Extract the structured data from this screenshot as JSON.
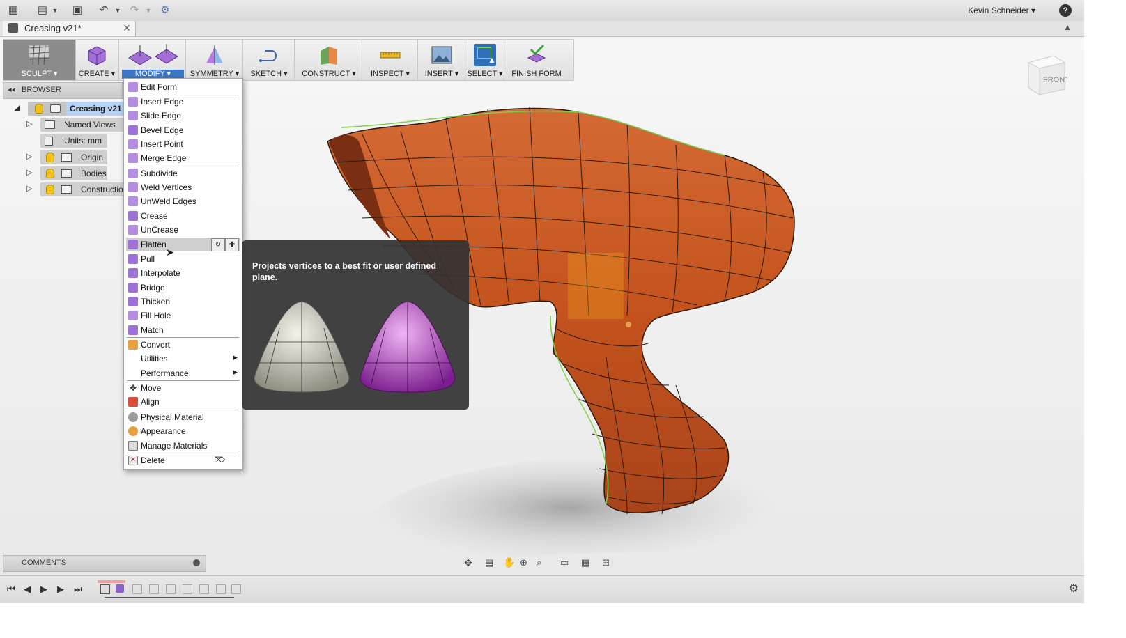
{
  "app": {
    "user": "Kevin Schneider",
    "help": "?"
  },
  "tab": {
    "title": "Creasing v21*"
  },
  "toolbar": {
    "sculpt": "SCULPT",
    "create": "CREATE",
    "modify": "MODIFY",
    "symmetry": "SYMMETRY",
    "sketch": "SKETCH",
    "construct": "CONSTRUCT",
    "inspect": "INSPECT",
    "insert": "INSERT",
    "select": "SELECT",
    "finish_form": "FINISH FORM"
  },
  "browser": {
    "title": "BROWSER",
    "items": [
      {
        "label": "Creasing v21"
      },
      {
        "label": "Named Views"
      },
      {
        "label": "Units: mm"
      },
      {
        "label": "Origin"
      },
      {
        "label": "Bodies"
      },
      {
        "label": "Constructio"
      }
    ]
  },
  "modify_menu": {
    "items": [
      {
        "label": "Edit Form"
      },
      {
        "label": "Insert Edge"
      },
      {
        "label": "Slide Edge"
      },
      {
        "label": "Bevel Edge"
      },
      {
        "label": "Insert Point"
      },
      {
        "label": "Merge Edge"
      },
      {
        "label": "Subdivide"
      },
      {
        "label": "Weld Vertices"
      },
      {
        "label": "UnWeld Edges"
      },
      {
        "label": "Crease"
      },
      {
        "label": "UnCrease"
      },
      {
        "label": "Flatten"
      },
      {
        "label": "Pull"
      },
      {
        "label": "Interpolate"
      },
      {
        "label": "Bridge"
      },
      {
        "label": "Thicken"
      },
      {
        "label": "Fill Hole"
      },
      {
        "label": "Match"
      },
      {
        "label": "Convert"
      },
      {
        "label": "Utilities"
      },
      {
        "label": "Performance"
      },
      {
        "label": "Move"
      },
      {
        "label": "Align"
      },
      {
        "label": "Physical Material"
      },
      {
        "label": "Appearance"
      },
      {
        "label": "Manage Materials"
      },
      {
        "label": "Delete"
      }
    ]
  },
  "tooltip": {
    "text": "Projects vertices to a best fit or user defined plane."
  },
  "comments": {
    "label": "COMMENTS"
  },
  "viewcube": {
    "face": "FRONT"
  },
  "colors": {
    "accent": "#3b77c6",
    "model": "#c8541e",
    "menu_highlight": "#cfcfcf"
  }
}
